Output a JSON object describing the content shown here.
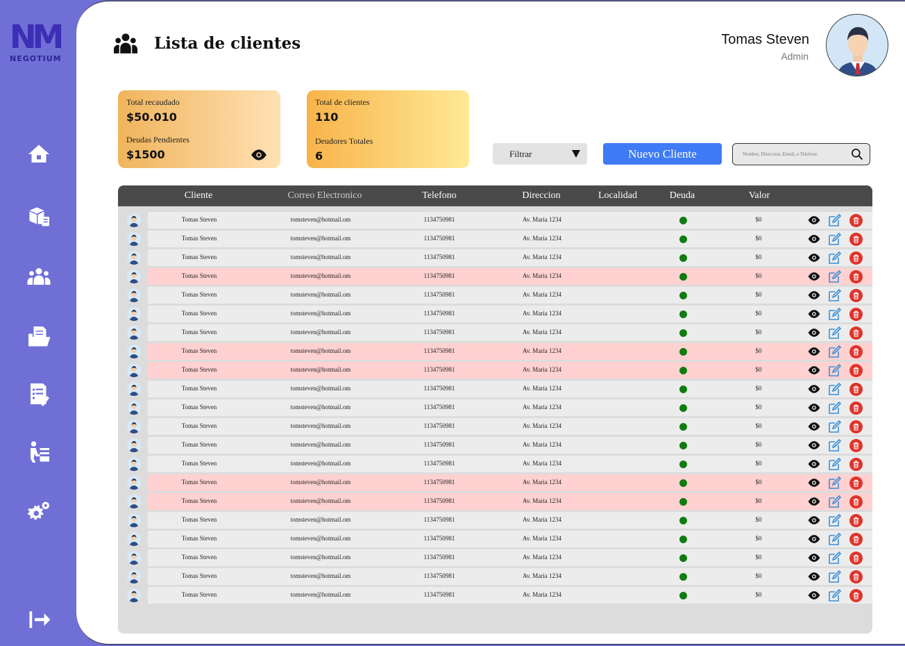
{
  "brand": {
    "logo_mark": "NM",
    "logo_text": "NEGOTIUM"
  },
  "sidebar": {
    "items": [
      {
        "name": "home-icon"
      },
      {
        "name": "products-icon"
      },
      {
        "name": "clients-icon"
      },
      {
        "name": "folder-icon"
      },
      {
        "name": "reports-icon"
      },
      {
        "name": "employees-icon"
      },
      {
        "name": "settings-icon"
      }
    ],
    "logout": "logout-icon"
  },
  "header": {
    "title": "Lista de clientes",
    "user_name": "Tomas Steven",
    "user_role": "Admin"
  },
  "summary": {
    "card1": {
      "label_1": "Total recaudado",
      "value_1": "$50.010",
      "label_2": "Deudas Pendientes",
      "value_2": "$1500"
    },
    "card2": {
      "label_1": "Total de clientes",
      "value_1": "110",
      "label_2": "Deudores Totales",
      "value_2": "6"
    }
  },
  "toolbar": {
    "filter_label": "Filtrar",
    "new_client_label": "Nuevo Cliente",
    "search_placeholder": "Nombre, Direccion, Email, o Telefono"
  },
  "table": {
    "headers": [
      "Cliente",
      "Correo Electronico",
      "Telefono",
      "Direccion",
      "Localidad",
      "Deuda",
      "Valor"
    ],
    "rows": [
      {
        "cliente": "Tomas Steven",
        "correo": "tomsteven@hotmail.om",
        "telefono": "1134750981",
        "direccion": "Av. Maria 1234",
        "valor": "$0",
        "highlight": false
      },
      {
        "cliente": "Tomas Steven",
        "correo": "tomsteven@hotmail.om",
        "telefono": "1134750981",
        "direccion": "Av. Maria 1234",
        "valor": "$0",
        "highlight": false
      },
      {
        "cliente": "Tomas Steven",
        "correo": "tomsteven@hotmail.om",
        "telefono": "1134750981",
        "direccion": "Av. Maria 1234",
        "valor": "$0",
        "highlight": false
      },
      {
        "cliente": "Tomas Steven",
        "correo": "tomsteven@hotmail.om",
        "telefono": "1134750981",
        "direccion": "Av. Maria 1234",
        "valor": "$0",
        "highlight": true
      },
      {
        "cliente": "Tomas Steven",
        "correo": "tomsteven@hotmail.om",
        "telefono": "1134750981",
        "direccion": "Av. Maria 1234",
        "valor": "$0",
        "highlight": false
      },
      {
        "cliente": "Tomas Steven",
        "correo": "tomsteven@hotmail.om",
        "telefono": "1134750981",
        "direccion": "Av. Maria 1234",
        "valor": "$0",
        "highlight": false
      },
      {
        "cliente": "Tomas Steven",
        "correo": "tomsteven@hotmail.om",
        "telefono": "1134750981",
        "direccion": "Av. Maria 1234",
        "valor": "$0",
        "highlight": false
      },
      {
        "cliente": "Tomas Steven",
        "correo": "tomsteven@hotmail.om",
        "telefono": "1134750981",
        "direccion": "Av. Maria 1234",
        "valor": "$0",
        "highlight": true
      },
      {
        "cliente": "Tomas Steven",
        "correo": "tomsteven@hotmail.om",
        "telefono": "1134750981",
        "direccion": "Av. Maria 1234",
        "valor": "$0",
        "highlight": true
      },
      {
        "cliente": "Tomas Steven",
        "correo": "tomsteven@hotmail.om",
        "telefono": "1134750981",
        "direccion": "Av. Maria 1234",
        "valor": "$0",
        "highlight": false
      },
      {
        "cliente": "Tomas Steven",
        "correo": "tomsteven@hotmail.om",
        "telefono": "1134750981",
        "direccion": "Av. Maria 1234",
        "valor": "$0",
        "highlight": false
      },
      {
        "cliente": "Tomas Steven",
        "correo": "tomsteven@hotmail.om",
        "telefono": "1134750981",
        "direccion": "Av. Maria 1234",
        "valor": "$0",
        "highlight": false
      },
      {
        "cliente": "Tomas Steven",
        "correo": "tomsteven@hotmail.om",
        "telefono": "1134750981",
        "direccion": "Av. Maria 1234",
        "valor": "$0",
        "highlight": false
      },
      {
        "cliente": "Tomas Steven",
        "correo": "tomsteven@hotmail.om",
        "telefono": "1134750981",
        "direccion": "Av. Maria 1234",
        "valor": "$0",
        "highlight": false
      },
      {
        "cliente": "Tomas Steven",
        "correo": "tomsteven@hotmail.om",
        "telefono": "1134750981",
        "direccion": "Av. Maria 1234",
        "valor": "$0",
        "highlight": true
      },
      {
        "cliente": "Tomas Steven",
        "correo": "tomsteven@hotmail.om",
        "telefono": "1134750981",
        "direccion": "Av. Maria 1234",
        "valor": "$0",
        "highlight": true
      },
      {
        "cliente": "Tomas Steven",
        "correo": "tomsteven@hotmail.om",
        "telefono": "1134750981",
        "direccion": "Av. Maria 1234",
        "valor": "$0",
        "highlight": false
      },
      {
        "cliente": "Tomas Steven",
        "correo": "tomsteven@hotmail.om",
        "telefono": "1134750981",
        "direccion": "Av. Maria 1234",
        "valor": "$0",
        "highlight": false
      },
      {
        "cliente": "Tomas Steven",
        "correo": "tomsteven@hotmail.om",
        "telefono": "1134750981",
        "direccion": "Av. Maria 1234",
        "valor": "$0",
        "highlight": false
      },
      {
        "cliente": "Tomas Steven",
        "correo": "tomsteven@hotmail.om",
        "telefono": "1134750981",
        "direccion": "Av. Maria 1234",
        "valor": "$0",
        "highlight": false
      },
      {
        "cliente": "Tomas Steven",
        "correo": "tomsteven@hotmail.om",
        "telefono": "1134750981",
        "direccion": "Av. Maria 1234",
        "valor": "$0",
        "highlight": false
      }
    ]
  },
  "colors": {
    "sidebar": "#6f6fd6",
    "accent_blue": "#3f7bf5",
    "debt_dot": "#107c10",
    "delete_red": "#e0342c",
    "highlight_row": "#ffd1d1"
  }
}
